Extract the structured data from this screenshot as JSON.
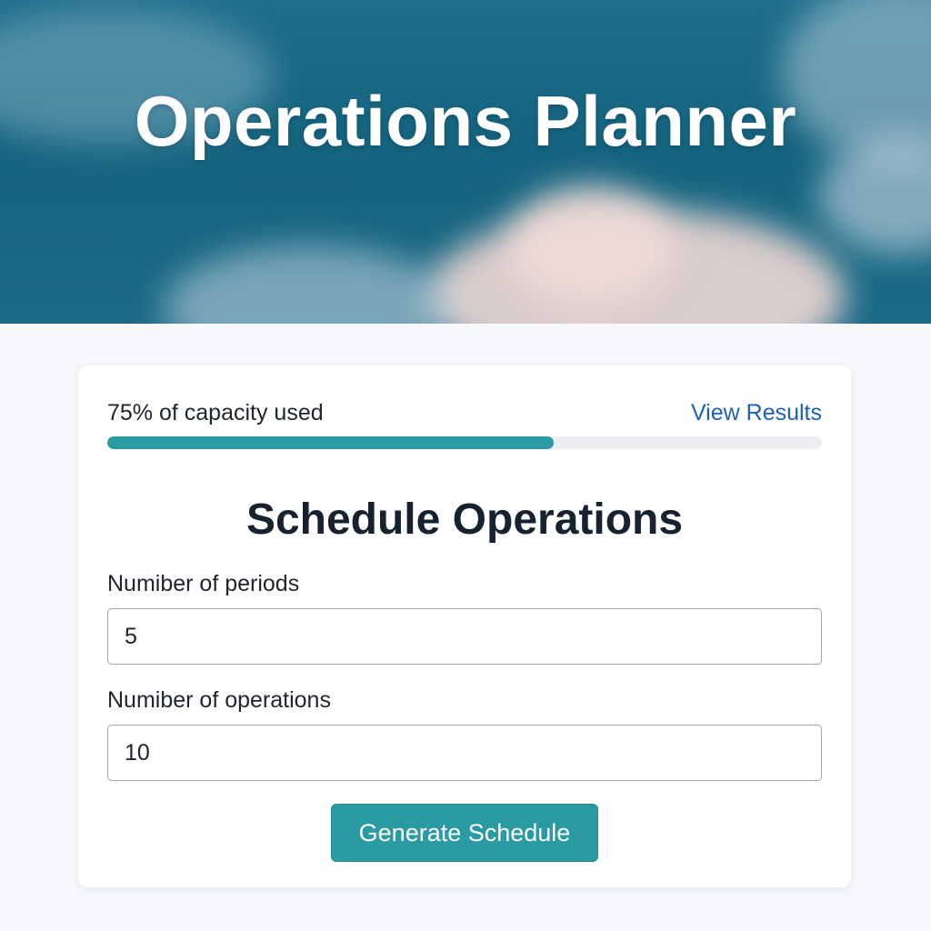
{
  "header": {
    "title": "Operations Planner"
  },
  "usage": {
    "label": "75% of capacity used",
    "fraction_filled": 0.625,
    "link_label": "View Results"
  },
  "form": {
    "title": "Schedule Operations",
    "periods": {
      "label": "Numiber of periods",
      "value": "5"
    },
    "operations": {
      "label": "Numiber of operations",
      "value": "10"
    },
    "submit_label": "Generate Schedule"
  },
  "colors": {
    "accent": "#2a9ba2",
    "link": "#1b63b0",
    "hero": "#14637f"
  }
}
